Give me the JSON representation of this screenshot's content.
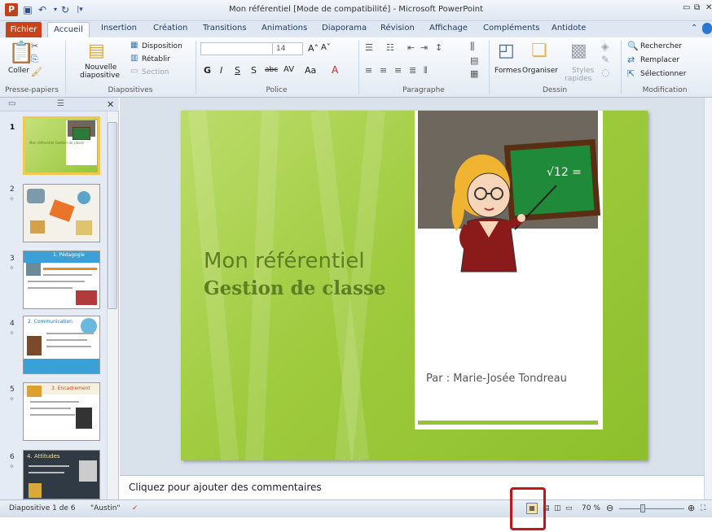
{
  "window": {
    "title": "Mon référentiel [Mode de compatibilité] - Microsoft PowerPoint",
    "app_icon": "P"
  },
  "tabs": [
    "Fichier",
    "Accueil",
    "Insertion",
    "Création",
    "Transitions",
    "Animations",
    "Diaporama",
    "Révision",
    "Affichage",
    "Compléments",
    "Antidote"
  ],
  "ribbon": {
    "clipboard": {
      "paste": "Coller",
      "label": "Presse-papiers"
    },
    "slides": {
      "new_slide_1": "Nouvelle",
      "new_slide_2": "diapositive",
      "layout": "Disposition",
      "reset": "Rétablir",
      "section": "Section",
      "label": "Diapositives"
    },
    "font": {
      "size": "14",
      "label": "Police"
    },
    "paragraph": {
      "label": "Paragraphe"
    },
    "drawing": {
      "shapes": "Formes",
      "arrange": "Organiser",
      "styles_1": "Styles",
      "styles_2": "rapides",
      "label": "Dessin"
    },
    "editing": {
      "find": "Rechercher",
      "replace": "Remplacer",
      "select": "Sélectionner",
      "label": "Modification"
    }
  },
  "slides_panel": {
    "slides": [
      {
        "num": "1",
        "title": "Mon référentiel Gestion de classe"
      },
      {
        "num": "2",
        "title": ""
      },
      {
        "num": "3",
        "title": "1. Pédagogie"
      },
      {
        "num": "4",
        "title": "2. Communication"
      },
      {
        "num": "5",
        "title": "3. Encadrement"
      },
      {
        "num": "6",
        "title": "4. Attitudes"
      }
    ]
  },
  "slide": {
    "title_line1": "Mon référentiel",
    "title_line2": "Gestion de classe",
    "author": "Par : Marie-Josée Tondreau",
    "board_text": "√12 ="
  },
  "notes": {
    "placeholder": "Cliquez pour ajouter des commentaires"
  },
  "status": {
    "slide_info": "Diapositive 1 de 6",
    "theme": "\"Austin\"",
    "zoom": "70 %"
  },
  "colors": {
    "file_tab": "#c8431b",
    "slide_green": "#9fcb3e",
    "title_green": "#5f7d22",
    "highlight": "#c0161c"
  }
}
